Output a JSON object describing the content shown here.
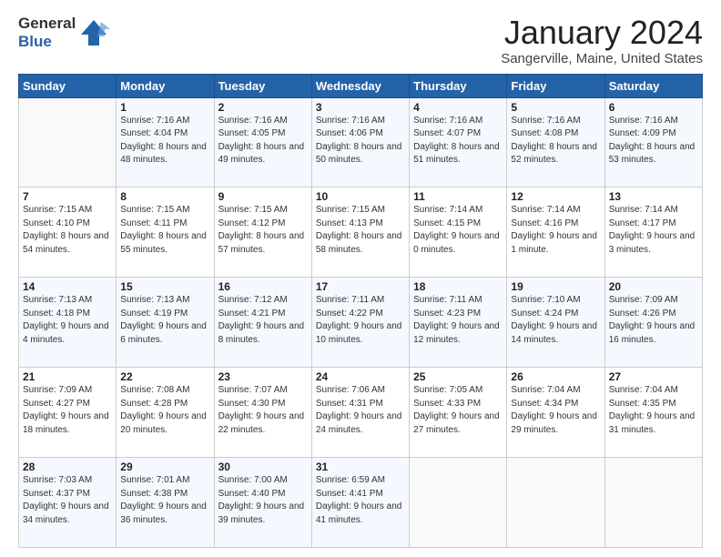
{
  "logo": {
    "general": "General",
    "blue": "Blue"
  },
  "header": {
    "title": "January 2024",
    "subtitle": "Sangerville, Maine, United States"
  },
  "weekdays": [
    "Sunday",
    "Monday",
    "Tuesday",
    "Wednesday",
    "Thursday",
    "Friday",
    "Saturday"
  ],
  "weeks": [
    [
      {
        "day": "",
        "sunrise": "",
        "sunset": "",
        "daylight": ""
      },
      {
        "day": "1",
        "sunrise": "Sunrise: 7:16 AM",
        "sunset": "Sunset: 4:04 PM",
        "daylight": "Daylight: 8 hours and 48 minutes."
      },
      {
        "day": "2",
        "sunrise": "Sunrise: 7:16 AM",
        "sunset": "Sunset: 4:05 PM",
        "daylight": "Daylight: 8 hours and 49 minutes."
      },
      {
        "day": "3",
        "sunrise": "Sunrise: 7:16 AM",
        "sunset": "Sunset: 4:06 PM",
        "daylight": "Daylight: 8 hours and 50 minutes."
      },
      {
        "day": "4",
        "sunrise": "Sunrise: 7:16 AM",
        "sunset": "Sunset: 4:07 PM",
        "daylight": "Daylight: 8 hours and 51 minutes."
      },
      {
        "day": "5",
        "sunrise": "Sunrise: 7:16 AM",
        "sunset": "Sunset: 4:08 PM",
        "daylight": "Daylight: 8 hours and 52 minutes."
      },
      {
        "day": "6",
        "sunrise": "Sunrise: 7:16 AM",
        "sunset": "Sunset: 4:09 PM",
        "daylight": "Daylight: 8 hours and 53 minutes."
      }
    ],
    [
      {
        "day": "7",
        "sunrise": "Sunrise: 7:15 AM",
        "sunset": "Sunset: 4:10 PM",
        "daylight": "Daylight: 8 hours and 54 minutes."
      },
      {
        "day": "8",
        "sunrise": "Sunrise: 7:15 AM",
        "sunset": "Sunset: 4:11 PM",
        "daylight": "Daylight: 8 hours and 55 minutes."
      },
      {
        "day": "9",
        "sunrise": "Sunrise: 7:15 AM",
        "sunset": "Sunset: 4:12 PM",
        "daylight": "Daylight: 8 hours and 57 minutes."
      },
      {
        "day": "10",
        "sunrise": "Sunrise: 7:15 AM",
        "sunset": "Sunset: 4:13 PM",
        "daylight": "Daylight: 8 hours and 58 minutes."
      },
      {
        "day": "11",
        "sunrise": "Sunrise: 7:14 AM",
        "sunset": "Sunset: 4:15 PM",
        "daylight": "Daylight: 9 hours and 0 minutes."
      },
      {
        "day": "12",
        "sunrise": "Sunrise: 7:14 AM",
        "sunset": "Sunset: 4:16 PM",
        "daylight": "Daylight: 9 hours and 1 minute."
      },
      {
        "day": "13",
        "sunrise": "Sunrise: 7:14 AM",
        "sunset": "Sunset: 4:17 PM",
        "daylight": "Daylight: 9 hours and 3 minutes."
      }
    ],
    [
      {
        "day": "14",
        "sunrise": "Sunrise: 7:13 AM",
        "sunset": "Sunset: 4:18 PM",
        "daylight": "Daylight: 9 hours and 4 minutes."
      },
      {
        "day": "15",
        "sunrise": "Sunrise: 7:13 AM",
        "sunset": "Sunset: 4:19 PM",
        "daylight": "Daylight: 9 hours and 6 minutes."
      },
      {
        "day": "16",
        "sunrise": "Sunrise: 7:12 AM",
        "sunset": "Sunset: 4:21 PM",
        "daylight": "Daylight: 9 hours and 8 minutes."
      },
      {
        "day": "17",
        "sunrise": "Sunrise: 7:11 AM",
        "sunset": "Sunset: 4:22 PM",
        "daylight": "Daylight: 9 hours and 10 minutes."
      },
      {
        "day": "18",
        "sunrise": "Sunrise: 7:11 AM",
        "sunset": "Sunset: 4:23 PM",
        "daylight": "Daylight: 9 hours and 12 minutes."
      },
      {
        "day": "19",
        "sunrise": "Sunrise: 7:10 AM",
        "sunset": "Sunset: 4:24 PM",
        "daylight": "Daylight: 9 hours and 14 minutes."
      },
      {
        "day": "20",
        "sunrise": "Sunrise: 7:09 AM",
        "sunset": "Sunset: 4:26 PM",
        "daylight": "Daylight: 9 hours and 16 minutes."
      }
    ],
    [
      {
        "day": "21",
        "sunrise": "Sunrise: 7:09 AM",
        "sunset": "Sunset: 4:27 PM",
        "daylight": "Daylight: 9 hours and 18 minutes."
      },
      {
        "day": "22",
        "sunrise": "Sunrise: 7:08 AM",
        "sunset": "Sunset: 4:28 PM",
        "daylight": "Daylight: 9 hours and 20 minutes."
      },
      {
        "day": "23",
        "sunrise": "Sunrise: 7:07 AM",
        "sunset": "Sunset: 4:30 PM",
        "daylight": "Daylight: 9 hours and 22 minutes."
      },
      {
        "day": "24",
        "sunrise": "Sunrise: 7:06 AM",
        "sunset": "Sunset: 4:31 PM",
        "daylight": "Daylight: 9 hours and 24 minutes."
      },
      {
        "day": "25",
        "sunrise": "Sunrise: 7:05 AM",
        "sunset": "Sunset: 4:33 PM",
        "daylight": "Daylight: 9 hours and 27 minutes."
      },
      {
        "day": "26",
        "sunrise": "Sunrise: 7:04 AM",
        "sunset": "Sunset: 4:34 PM",
        "daylight": "Daylight: 9 hours and 29 minutes."
      },
      {
        "day": "27",
        "sunrise": "Sunrise: 7:04 AM",
        "sunset": "Sunset: 4:35 PM",
        "daylight": "Daylight: 9 hours and 31 minutes."
      }
    ],
    [
      {
        "day": "28",
        "sunrise": "Sunrise: 7:03 AM",
        "sunset": "Sunset: 4:37 PM",
        "daylight": "Daylight: 9 hours and 34 minutes."
      },
      {
        "day": "29",
        "sunrise": "Sunrise: 7:01 AM",
        "sunset": "Sunset: 4:38 PM",
        "daylight": "Daylight: 9 hours and 36 minutes."
      },
      {
        "day": "30",
        "sunrise": "Sunrise: 7:00 AM",
        "sunset": "Sunset: 4:40 PM",
        "daylight": "Daylight: 9 hours and 39 minutes."
      },
      {
        "day": "31",
        "sunrise": "Sunrise: 6:59 AM",
        "sunset": "Sunset: 4:41 PM",
        "daylight": "Daylight: 9 hours and 41 minutes."
      },
      {
        "day": "",
        "sunrise": "",
        "sunset": "",
        "daylight": ""
      },
      {
        "day": "",
        "sunrise": "",
        "sunset": "",
        "daylight": ""
      },
      {
        "day": "",
        "sunrise": "",
        "sunset": "",
        "daylight": ""
      }
    ]
  ]
}
